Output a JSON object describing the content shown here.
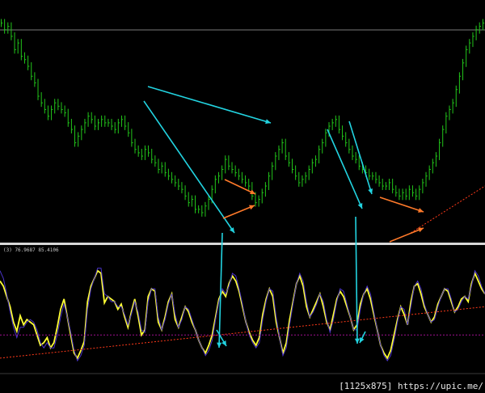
{
  "chart_data": [
    {
      "type": "line",
      "panel": "price",
      "style": "bar chart",
      "series": [
        {
          "color": "#22c51a",
          "values": [
            96,
            94,
            95,
            92,
            88,
            90,
            86,
            85,
            83,
            80,
            78,
            74,
            72,
            70,
            68,
            70,
            72,
            71,
            70,
            69,
            66,
            64,
            60,
            62,
            64,
            66,
            68,
            67,
            65,
            66,
            67,
            66,
            66,
            65,
            64,
            66,
            67,
            65,
            63,
            60,
            58,
            57,
            56,
            58,
            57,
            55,
            54,
            52,
            53,
            51,
            50,
            49,
            48,
            47,
            46,
            44,
            42,
            43,
            40,
            40,
            39,
            41,
            43,
            46,
            49,
            50,
            52,
            55,
            53,
            52,
            51,
            50,
            49,
            48,
            47,
            44,
            42,
            43,
            45,
            47,
            50,
            53,
            56,
            58,
            60,
            56,
            54,
            52,
            50,
            48,
            49,
            50,
            52,
            54,
            55,
            58,
            60,
            63,
            65,
            66,
            67,
            64,
            62,
            60,
            58,
            56,
            55,
            53,
            52,
            51,
            50,
            50,
            49,
            48,
            47,
            47,
            48,
            46,
            45,
            44,
            45,
            44,
            46,
            45,
            44,
            46,
            48,
            50,
            52,
            54,
            56,
            60,
            64,
            68,
            70,
            72,
            76,
            80,
            84,
            88,
            90,
            92,
            94,
            95,
            96
          ]
        }
      ],
      "ylim": [
        30,
        100
      ]
    },
    {
      "type": "line",
      "panel": "indicator",
      "label": "(3) 76.9687 85.4106",
      "series": [
        {
          "color": "#ffff33",
          "values": [
            72,
            68,
            60,
            52,
            40,
            33,
            45,
            38,
            42,
            40,
            38,
            30,
            22,
            24,
            28,
            20,
            24,
            36,
            50,
            58,
            44,
            30,
            16,
            12,
            18,
            25,
            56,
            68,
            74,
            80,
            78,
            55,
            60,
            58,
            56,
            50,
            54,
            44,
            36,
            48,
            58,
            45,
            30,
            34,
            60,
            66,
            64,
            40,
            34,
            44,
            56,
            62,
            42,
            36,
            44,
            52,
            48,
            40,
            34,
            26,
            20,
            16,
            22,
            30,
            44,
            58,
            64,
            60,
            70,
            76,
            72,
            64,
            52,
            40,
            32,
            26,
            22,
            28,
            46,
            58,
            66,
            60,
            40,
            28,
            16,
            24,
            42,
            56,
            70,
            76,
            68,
            52,
            44,
            50,
            56,
            62,
            52,
            40,
            34,
            46,
            58,
            64,
            60,
            52,
            44,
            34,
            38,
            54,
            62,
            66,
            58,
            46,
            34,
            22,
            16,
            12,
            18,
            30,
            42,
            52,
            46,
            38,
            56,
            68,
            70,
            62,
            52,
            46,
            40,
            44,
            54,
            60,
            66,
            64,
            56,
            48,
            52,
            58,
            60,
            56,
            70,
            78,
            72,
            66,
            62
          ]
        },
        {
          "color": "#4a34c8",
          "values": [
            80,
            74,
            62,
            48,
            36,
            28,
            36,
            36,
            40,
            42,
            40,
            34,
            24,
            20,
            24,
            20,
            20,
            30,
            44,
            54,
            44,
            32,
            18,
            10,
            14,
            22,
            50,
            66,
            74,
            82,
            82,
            62,
            60,
            56,
            56,
            52,
            52,
            46,
            38,
            46,
            56,
            48,
            34,
            32,
            56,
            66,
            66,
            44,
            34,
            42,
            54,
            62,
            46,
            36,
            42,
            52,
            50,
            42,
            34,
            26,
            20,
            14,
            18,
            26,
            42,
            56,
            66,
            62,
            68,
            78,
            76,
            66,
            54,
            40,
            30,
            24,
            20,
            24,
            42,
            56,
            66,
            64,
            44,
            28,
            14,
            20,
            38,
            54,
            70,
            78,
            72,
            56,
            44,
            48,
            54,
            62,
            56,
            42,
            32,
            42,
            56,
            66,
            64,
            54,
            44,
            34,
            34,
            50,
            62,
            68,
            62,
            48,
            34,
            22,
            14,
            10,
            14,
            26,
            40,
            52,
            50,
            38,
            52,
            68,
            72,
            66,
            54,
            46,
            40,
            42,
            52,
            60,
            66,
            66,
            58,
            48,
            50,
            56,
            60,
            58,
            68,
            80,
            76,
            68,
            62
          ]
        },
        {
          "color": "#ff3a1a",
          "dashed": true,
          "values": [
            12,
            52
          ]
        },
        {
          "color": "#a01090",
          "dashed": true,
          "values": [
            30,
            30
          ]
        }
      ]
    }
  ],
  "annotations": {
    "cyan_color": "#22d3e0",
    "orange_color": "#ff7a2a"
  },
  "footer_text": "[1125x875] https://upic.me/"
}
